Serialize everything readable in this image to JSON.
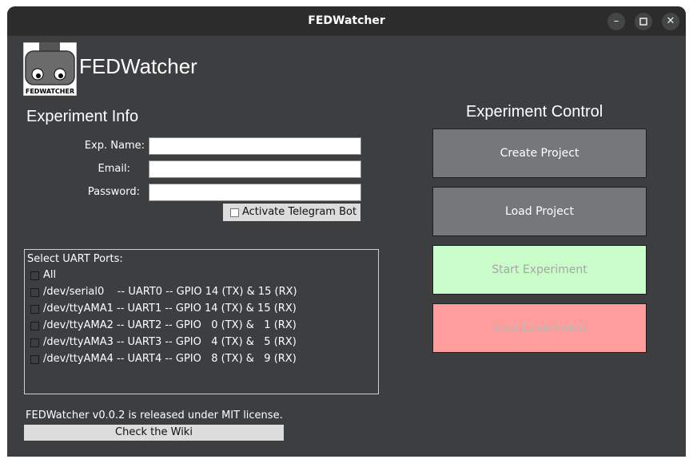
{
  "window": {
    "title": "FEDWatcher",
    "controls": [
      "minimize-icon",
      "maximize-icon",
      "close-icon"
    ]
  },
  "app": {
    "name": "FEDWatcher",
    "logo_text": "FEDWATCHER"
  },
  "experiment_info": {
    "title": "Experiment Info",
    "fields": [
      {
        "label": "Exp. Name:",
        "value": ""
      },
      {
        "label": "Email:",
        "value": ""
      },
      {
        "label": "Password:",
        "value": ""
      }
    ],
    "telegram_checkbox": {
      "label": "Activate Telegram Bot",
      "checked": false
    }
  },
  "uart": {
    "title": "Select UART Ports:",
    "ports": [
      {
        "label": "All",
        "checked": false
      },
      {
        "label": "/dev/serial0    -- UART0 -- GPIO 14 (TX) & 15 (RX)",
        "checked": false
      },
      {
        "label": "/dev/ttyAMA1 -- UART1 -- GPIO 14 (TX) & 15 (RX)",
        "checked": false
      },
      {
        "label": "/dev/ttyAMA2 -- UART2 -- GPIO   0 (TX) &   1 (RX)",
        "checked": false
      },
      {
        "label": "/dev/ttyAMA3 -- UART3 -- GPIO   4 (TX) &   5 (RX)",
        "checked": false
      },
      {
        "label": "/dev/ttyAMA4 -- UART4 -- GPIO   8 (TX) &   9 (RX)",
        "checked": false
      }
    ]
  },
  "experiment_control": {
    "title": "Experiment Control",
    "buttons": [
      {
        "label": "Create Project",
        "bg": "#75787b",
        "fg": "#ffffff"
      },
      {
        "label": "Load Project",
        "bg": "#75787b",
        "fg": "#ffffff"
      },
      {
        "label": "Start Experiment",
        "bg": "#c9fcc9",
        "fg": "#a6a6a6"
      },
      {
        "label": "Stop Experiment",
        "bg": "#ff9c9c",
        "fg": "#b8b8b8"
      }
    ]
  },
  "footer": {
    "license_text": "FEDWatcher v0.0.2 is released under MIT license.",
    "wiki_button": "Check the Wiki"
  }
}
